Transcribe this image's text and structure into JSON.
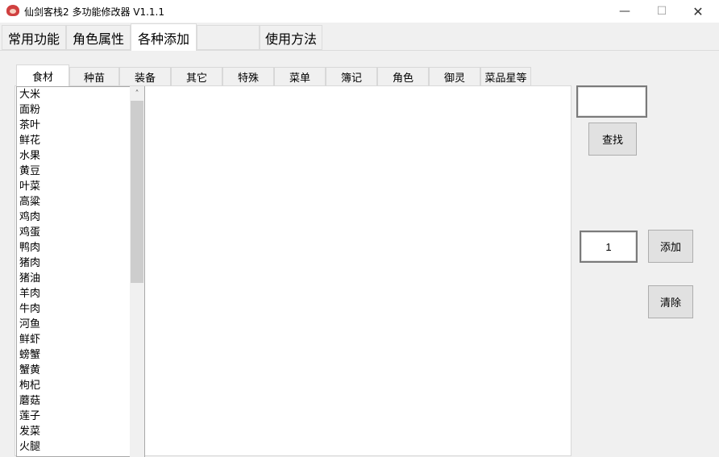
{
  "window": {
    "title": "仙剑客栈2 多功能修改器  V1.1.1",
    "minimize": "—",
    "maximize": "☐",
    "close": "✕"
  },
  "main_tabs": [
    "常用功能",
    "角色属性",
    "各种添加",
    "使用方法"
  ],
  "sub_tabs": [
    "食材",
    "种苗",
    "装备",
    "其它",
    "特殊",
    "菜单",
    "簿记",
    "角色",
    "御灵",
    "菜品星等"
  ],
  "items": [
    "大米",
    "面粉",
    "茶叶",
    "鲜花",
    "水果",
    "黄豆",
    "叶菜",
    "高粱",
    "鸡肉",
    "鸡蛋",
    "鸭肉",
    "猪肉",
    "猪油",
    "羊肉",
    "牛肉",
    "河鱼",
    "鲜虾",
    "螃蟹",
    "蟹黄",
    "枸杞",
    "蘑菇",
    "莲子",
    "发菜",
    "火腿"
  ],
  "search": {
    "value": "",
    "button": "查找"
  },
  "quantity": {
    "value": "1"
  },
  "add_button": "添加",
  "clear_button": "清除",
  "scrollbar": {
    "up": "˄"
  }
}
